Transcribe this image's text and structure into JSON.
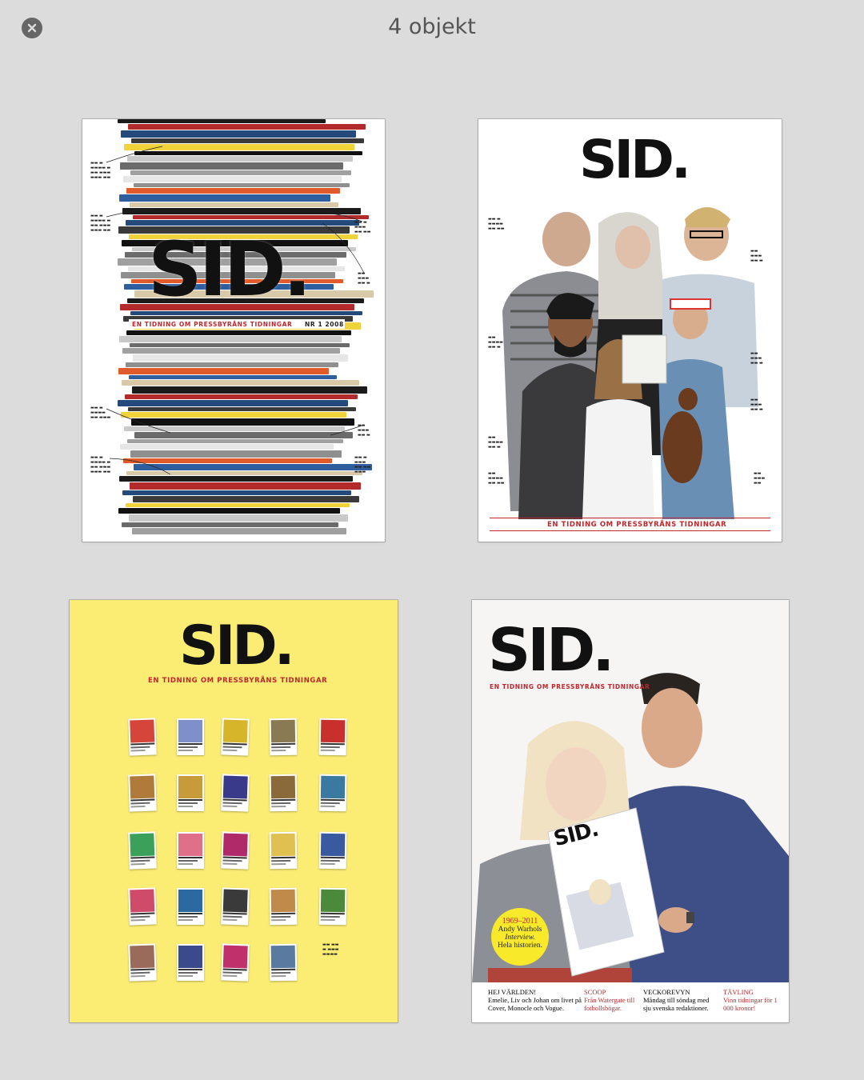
{
  "window": {
    "title": "4 objekt",
    "close_icon": "close-circle-icon"
  },
  "covers": [
    {
      "logo": "SID.",
      "tagline": "EN TIDNING OM PRESSBYRÅNS TIDNINGAR",
      "issue": "NR 1 2008"
    },
    {
      "logo": "SID.",
      "tagline": "EN TIDNING OM PRESSBYRÅNS TIDNINGAR"
    },
    {
      "logo": "SID.",
      "tagline": "EN TIDNING OM PRESSBYRÅNS TIDNINGAR"
    },
    {
      "logo": "SID.",
      "tagline": "EN TIDNING OM PRESSBYRÅNS TIDNINGAR",
      "inset_logo": "SID.",
      "badge": {
        "line1": "1969–2011",
        "line2": "Andy Warhols",
        "line3": "Interview.",
        "line4": "Hela historien."
      },
      "bottom": [
        {
          "head": "HEJ VÄRLDEN!",
          "text": "Emelie, Liv och Johan om livet på Cover, Monocle och Vogue."
        },
        {
          "head": "SCOOP",
          "text": "Från Watergate till fotbollsbögar."
        },
        {
          "head": "VECKOREVYN",
          "text": "Måndag till söndag med sju svenska redaktioner."
        },
        {
          "head": "TÄVLING",
          "text": "Vinn tidningar för 1 000 kronor!"
        }
      ]
    }
  ],
  "colors": {
    "background": "#dcdcdc",
    "accent_red": "#c0272d",
    "yellow": "#fbed74"
  }
}
